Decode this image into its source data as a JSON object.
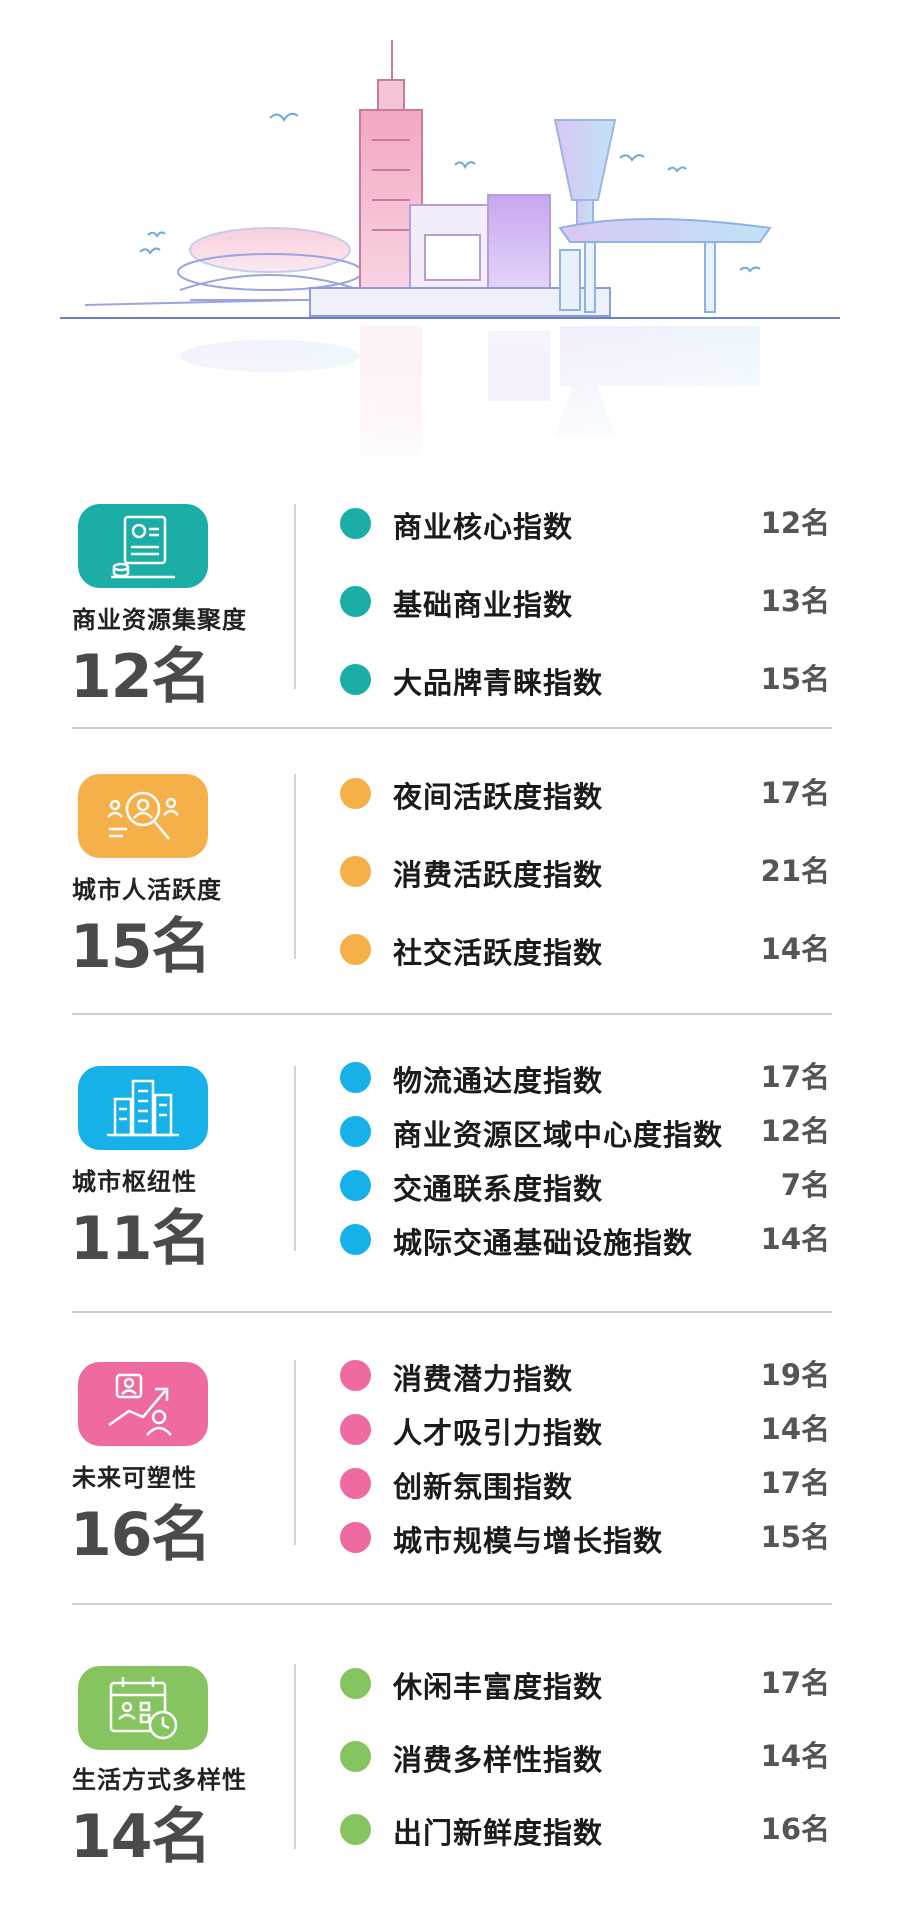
{
  "colors": {
    "commerce": "#1aaea7",
    "vitality": "#f6b04a",
    "hub": "#17b1ea",
    "future": "#ee6aa0",
    "lifestyle": "#86c45f",
    "divider": "#cfcfcf"
  },
  "skyline": {
    "icon": "city-skyline-illustration"
  },
  "sections": [
    {
      "category": "商业资源集聚度",
      "rank": "12名",
      "icon": "business-document-icon",
      "items": [
        {
          "label": "商业核心指数",
          "rank": "12名"
        },
        {
          "label": "基础商业指数",
          "rank": "13名"
        },
        {
          "label": "大品牌青睐指数",
          "rank": "15名"
        }
      ]
    },
    {
      "category": "城市人活跃度",
      "rank": "15名",
      "icon": "people-search-icon",
      "items": [
        {
          "label": "夜间活跃度指数",
          "rank": "17名"
        },
        {
          "label": "消费活跃度指数",
          "rank": "21名"
        },
        {
          "label": "社交活跃度指数",
          "rank": "14名"
        }
      ]
    },
    {
      "category": "城市枢纽性",
      "rank": "11名",
      "icon": "city-buildings-icon",
      "items": [
        {
          "label": "物流通达度指数",
          "rank": "17名"
        },
        {
          "label": "商业资源区域中心度指数",
          "rank": "12名"
        },
        {
          "label": "交通联系度指数",
          "rank": "7名"
        },
        {
          "label": "城际交通基础设施指数",
          "rank": "14名"
        }
      ]
    },
    {
      "category": "未来可塑性",
      "rank": "16名",
      "icon": "growth-chart-icon",
      "items": [
        {
          "label": "消费潜力指数",
          "rank": "19名"
        },
        {
          "label": "人才吸引力指数",
          "rank": "14名"
        },
        {
          "label": "创新氛围指数",
          "rank": "17名"
        },
        {
          "label": "城市规模与增长指数",
          "rank": "15名"
        }
      ]
    },
    {
      "category": "生活方式多样性",
      "rank": "14名",
      "icon": "calendar-clock-icon",
      "items": [
        {
          "label": "休闲丰富度指数",
          "rank": "17名"
        },
        {
          "label": "消费多样性指数",
          "rank": "14名"
        },
        {
          "label": "出门新鲜度指数",
          "rank": "16名"
        }
      ]
    }
  ]
}
